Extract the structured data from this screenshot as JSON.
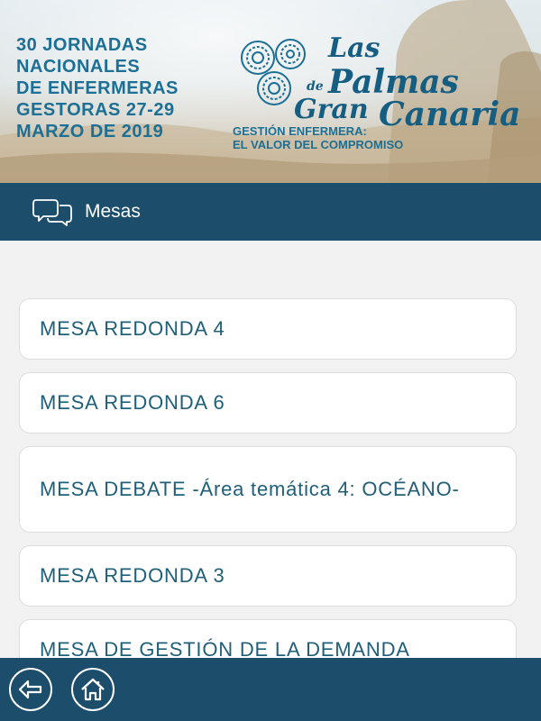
{
  "banner": {
    "title_lines": [
      "30 JORNADAS",
      "NACIONALES",
      "DE ENFERMERAS",
      "GESTORAS 27-29",
      "MARZO DE 2019"
    ],
    "logo": {
      "las": "Las",
      "de": "de",
      "palmas": "Palmas",
      "gran": "Gran",
      "canaria": "Canaria"
    },
    "subtitle_lines": [
      "GESTIÓN ENFERMERA:",
      "EL VALOR DEL COMPROMISO"
    ]
  },
  "header": {
    "icon": "chat-bubbles-icon",
    "title": "Mesas"
  },
  "list": {
    "items": [
      {
        "label": "MESA REDONDA 4"
      },
      {
        "label": "MESA REDONDA 6"
      },
      {
        "label": "MESA DEBATE -Área temática 4: OCÉANO-"
      },
      {
        "label": "MESA REDONDA 3"
      },
      {
        "label": "MESA DE GESTIÓN DE LA DEMANDA"
      }
    ]
  },
  "footer": {
    "back_icon": "back-arrow-icon",
    "home_icon": "home-icon"
  },
  "colors": {
    "primary": "#1c4d6b",
    "item_text": "#205f78",
    "banner_text": "#1c6f95"
  }
}
